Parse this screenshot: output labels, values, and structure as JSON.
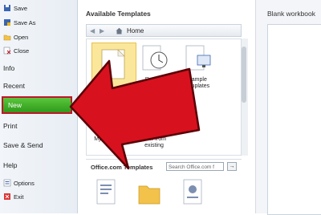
{
  "menu": {
    "small_items": [
      "Save",
      "Save As",
      "Open",
      "Close"
    ],
    "recent": "Recent",
    "info": "Info",
    "new": "New",
    "print": "Print",
    "save_send": "Save & Send",
    "help": "Help",
    "options": "Options",
    "exit": "Exit"
  },
  "center": {
    "available_title": "Available Templates",
    "nav_home": "Home",
    "tiles": {
      "blank": "Blank workbook",
      "recent": "Recent templates",
      "sample": "Sample templates",
      "my_templates": "My templates",
      "new_from_existing": "New from existing"
    },
    "office_templates_label": "Office.com Templates",
    "office_search_placeholder": "Search Office.com f"
  },
  "right": {
    "title": "Blank workbook"
  },
  "colors": {
    "new_green": "#2e9a1b",
    "arrow_red": "#d8111f"
  }
}
